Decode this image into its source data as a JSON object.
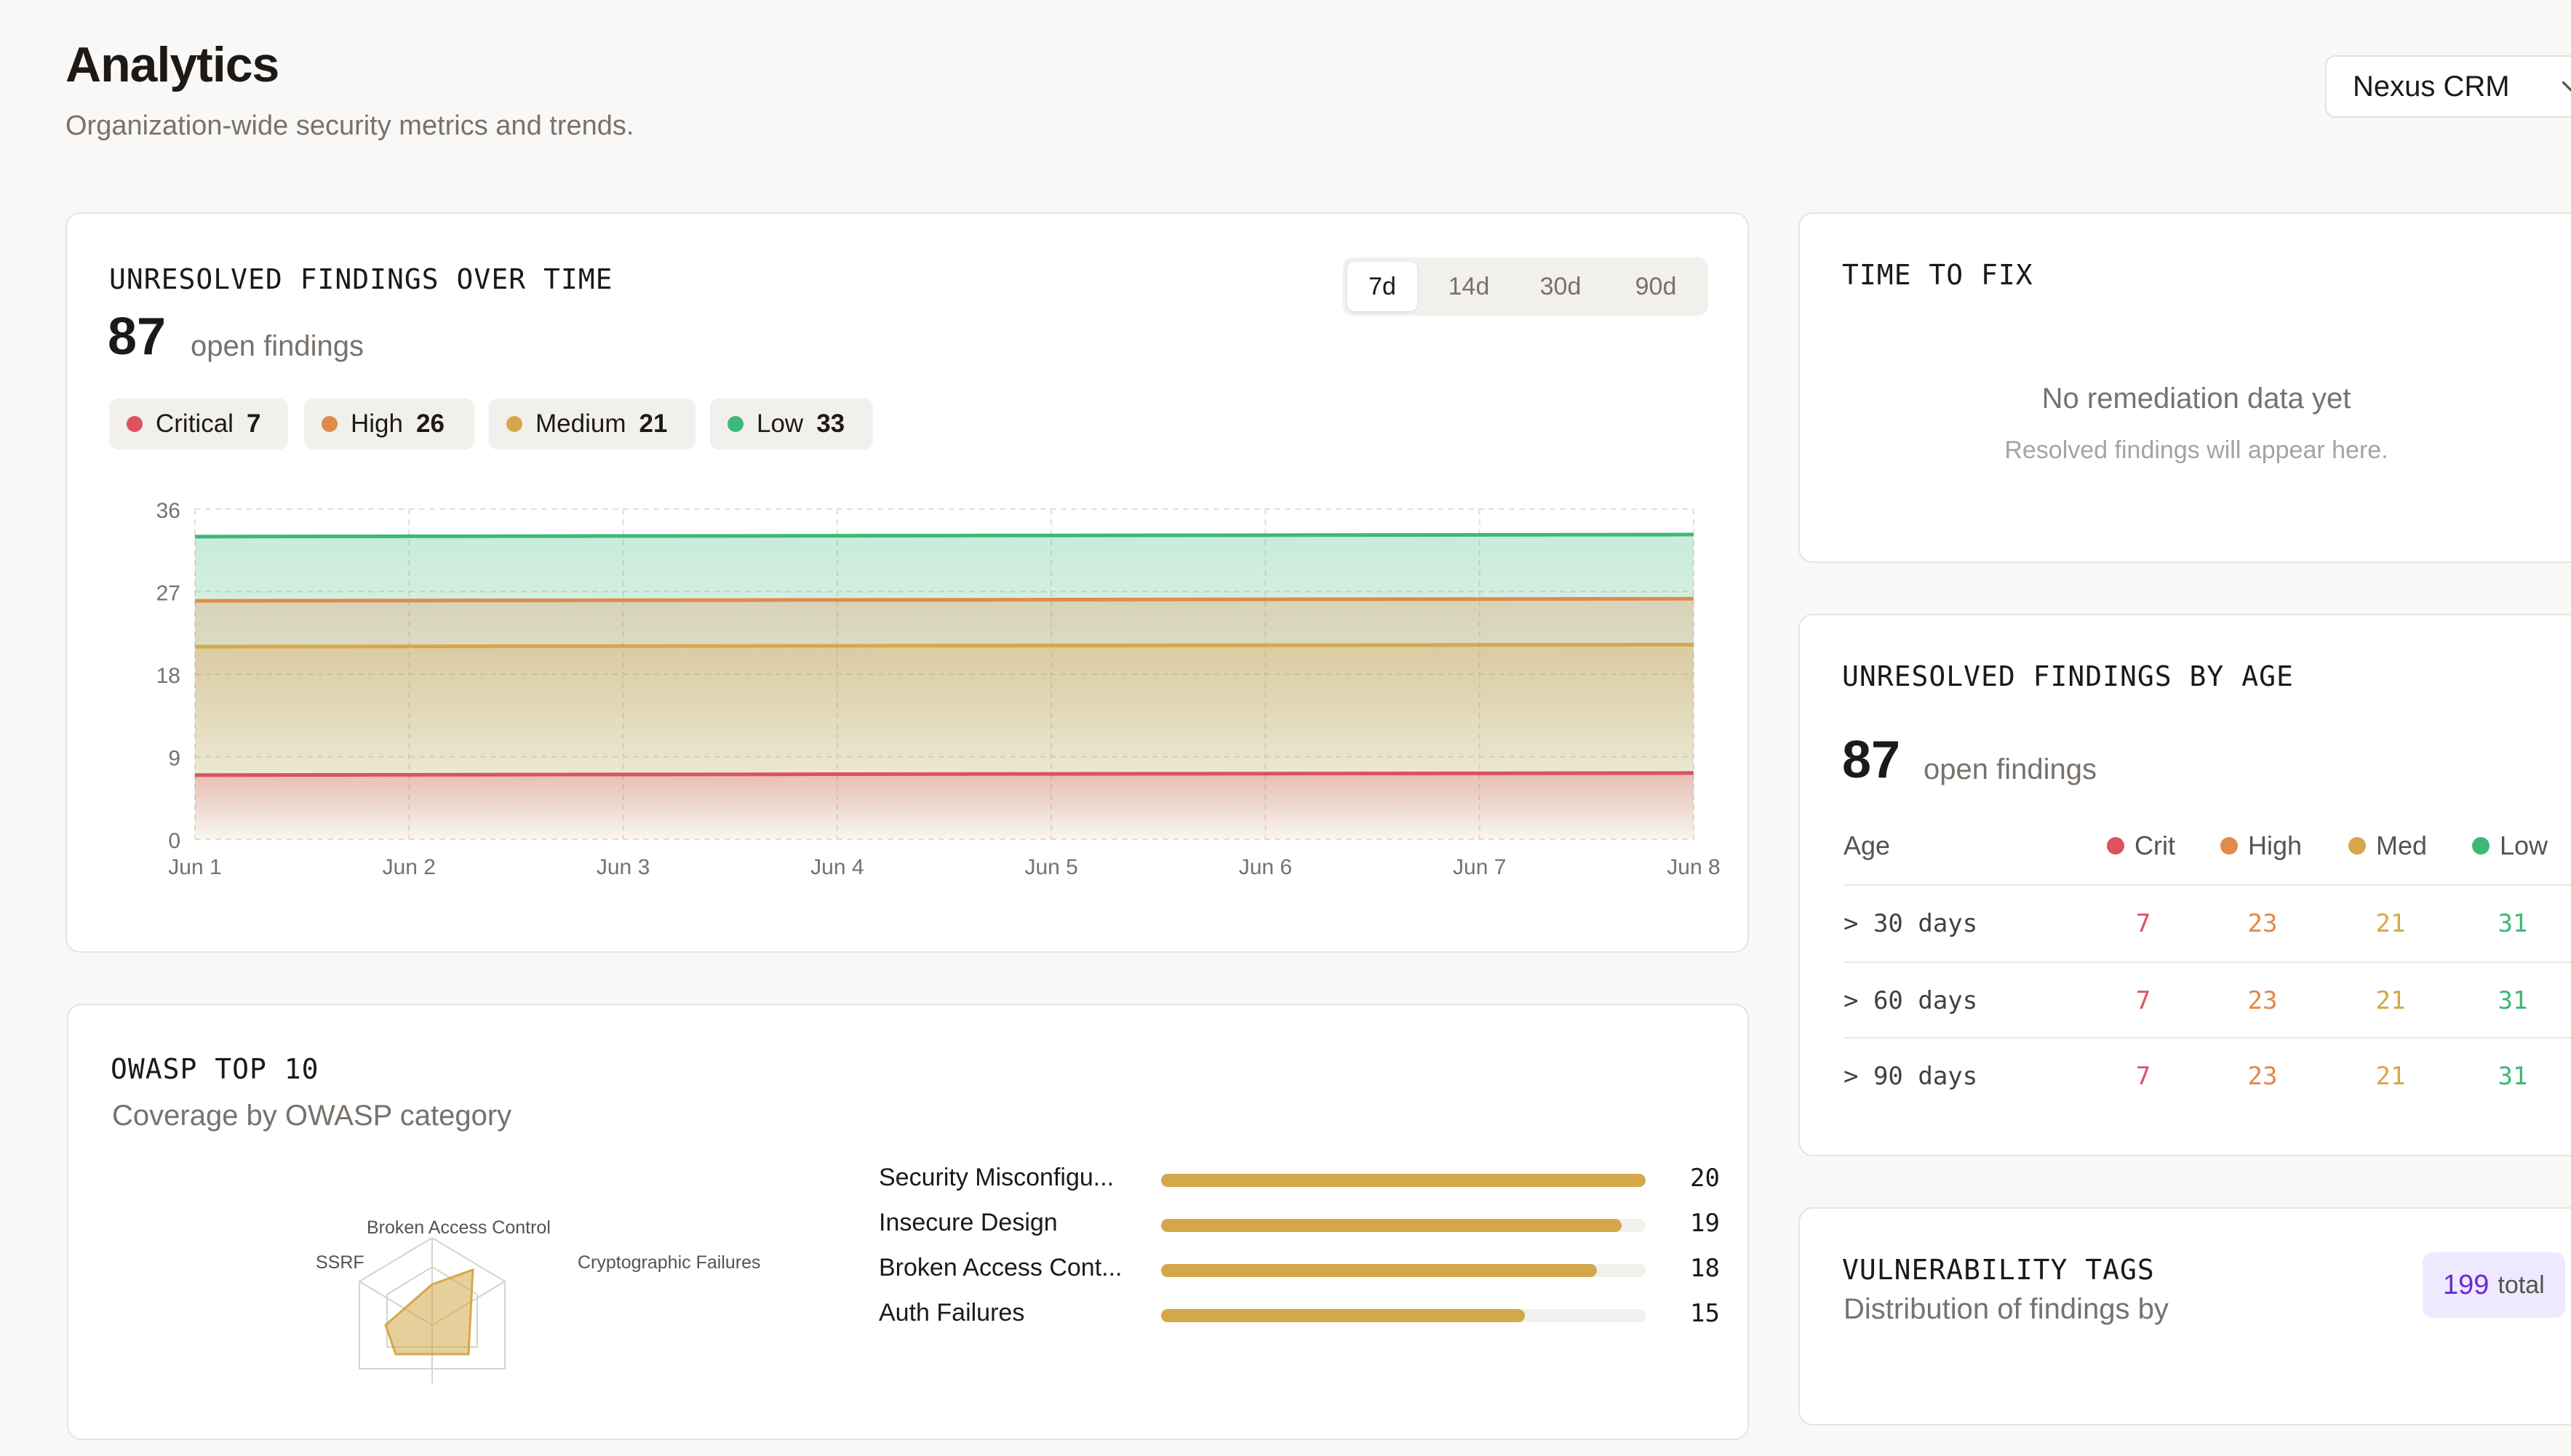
{
  "header": {
    "title": "Analytics",
    "subtitle": "Organization-wide security metrics and trends.",
    "project_select": "Nexus CRM"
  },
  "findings_over_time": {
    "title": "UNRESOLVED FINDINGS OVER TIME",
    "count": "87",
    "count_label": "open findings",
    "ranges": [
      "7d",
      "14d",
      "30d",
      "90d"
    ],
    "active_range": "7d",
    "severities": [
      {
        "label": "Critical",
        "count": "7",
        "color": "#dc5260"
      },
      {
        "label": "High",
        "count": "26",
        "color": "#e08a4c"
      },
      {
        "label": "Medium",
        "count": "21",
        "color": "#d4a84a"
      },
      {
        "label": "Low",
        "count": "33",
        "color": "#3cb878"
      }
    ]
  },
  "chart_data": {
    "type": "area",
    "x": [
      "Jun 1",
      "Jun 2",
      "Jun 3",
      "Jun 4",
      "Jun 5",
      "Jun 6",
      "Jun 7",
      "Jun 8"
    ],
    "ylim": [
      0,
      36
    ],
    "yticks": [
      0,
      9,
      18,
      27,
      36
    ],
    "grid": true,
    "series": [
      {
        "name": "Critical",
        "values": [
          7,
          7,
          7,
          7,
          7,
          7,
          7,
          7
        ],
        "color": "#dc5260"
      },
      {
        "name": "Medium",
        "values": [
          21,
          21,
          21,
          21,
          21,
          21,
          21,
          21
        ],
        "color": "#d4a84a"
      },
      {
        "name": "High",
        "values": [
          26,
          26,
          26,
          26,
          26,
          26,
          26,
          26
        ],
        "color": "#e08a4c"
      },
      {
        "name": "Low",
        "values": [
          33,
          33,
          33,
          33,
          33,
          33,
          33,
          33
        ],
        "color": "#3cb878"
      }
    ]
  },
  "time_to_fix": {
    "title": "TIME TO FIX",
    "empty_title": "No remediation data yet",
    "empty_sub": "Resolved findings will appear here."
  },
  "by_age": {
    "title": "UNRESOLVED FINDINGS BY AGE",
    "count": "87",
    "count_label": "open findings",
    "age_header": "Age",
    "columns": [
      {
        "label": "Crit",
        "color": "#dc5260"
      },
      {
        "label": "High",
        "color": "#e08a4c"
      },
      {
        "label": "Med",
        "color": "#d4a84a"
      },
      {
        "label": "Low",
        "color": "#3cb878"
      }
    ],
    "rows": [
      {
        "age": "> 30 days",
        "values": [
          "7",
          "23",
          "21",
          "31"
        ]
      },
      {
        "age": "> 60 days",
        "values": [
          "7",
          "23",
          "21",
          "31"
        ]
      },
      {
        "age": "> 90 days",
        "values": [
          "7",
          "23",
          "21",
          "31"
        ]
      }
    ]
  },
  "vuln_tags": {
    "title": "VULNERABILITY TAGS",
    "total": "199",
    "total_word": "total",
    "subtitle": "Distribution of findings by"
  },
  "owasp": {
    "title": "OWASP TOP 10",
    "subtitle": "Coverage by OWASP category",
    "bar_color": "#d4a84a",
    "max": 20,
    "bars": [
      {
        "label": "Security Misconfigu...",
        "value": 20
      },
      {
        "label": "Insecure Design",
        "value": 19
      },
      {
        "label": "Broken Access Cont...",
        "value": 18
      },
      {
        "label": "Auth Failures",
        "value": 15
      }
    ],
    "radar_labels": [
      "Broken Access Control",
      "Cryptographic Failures",
      "SSRF"
    ]
  }
}
